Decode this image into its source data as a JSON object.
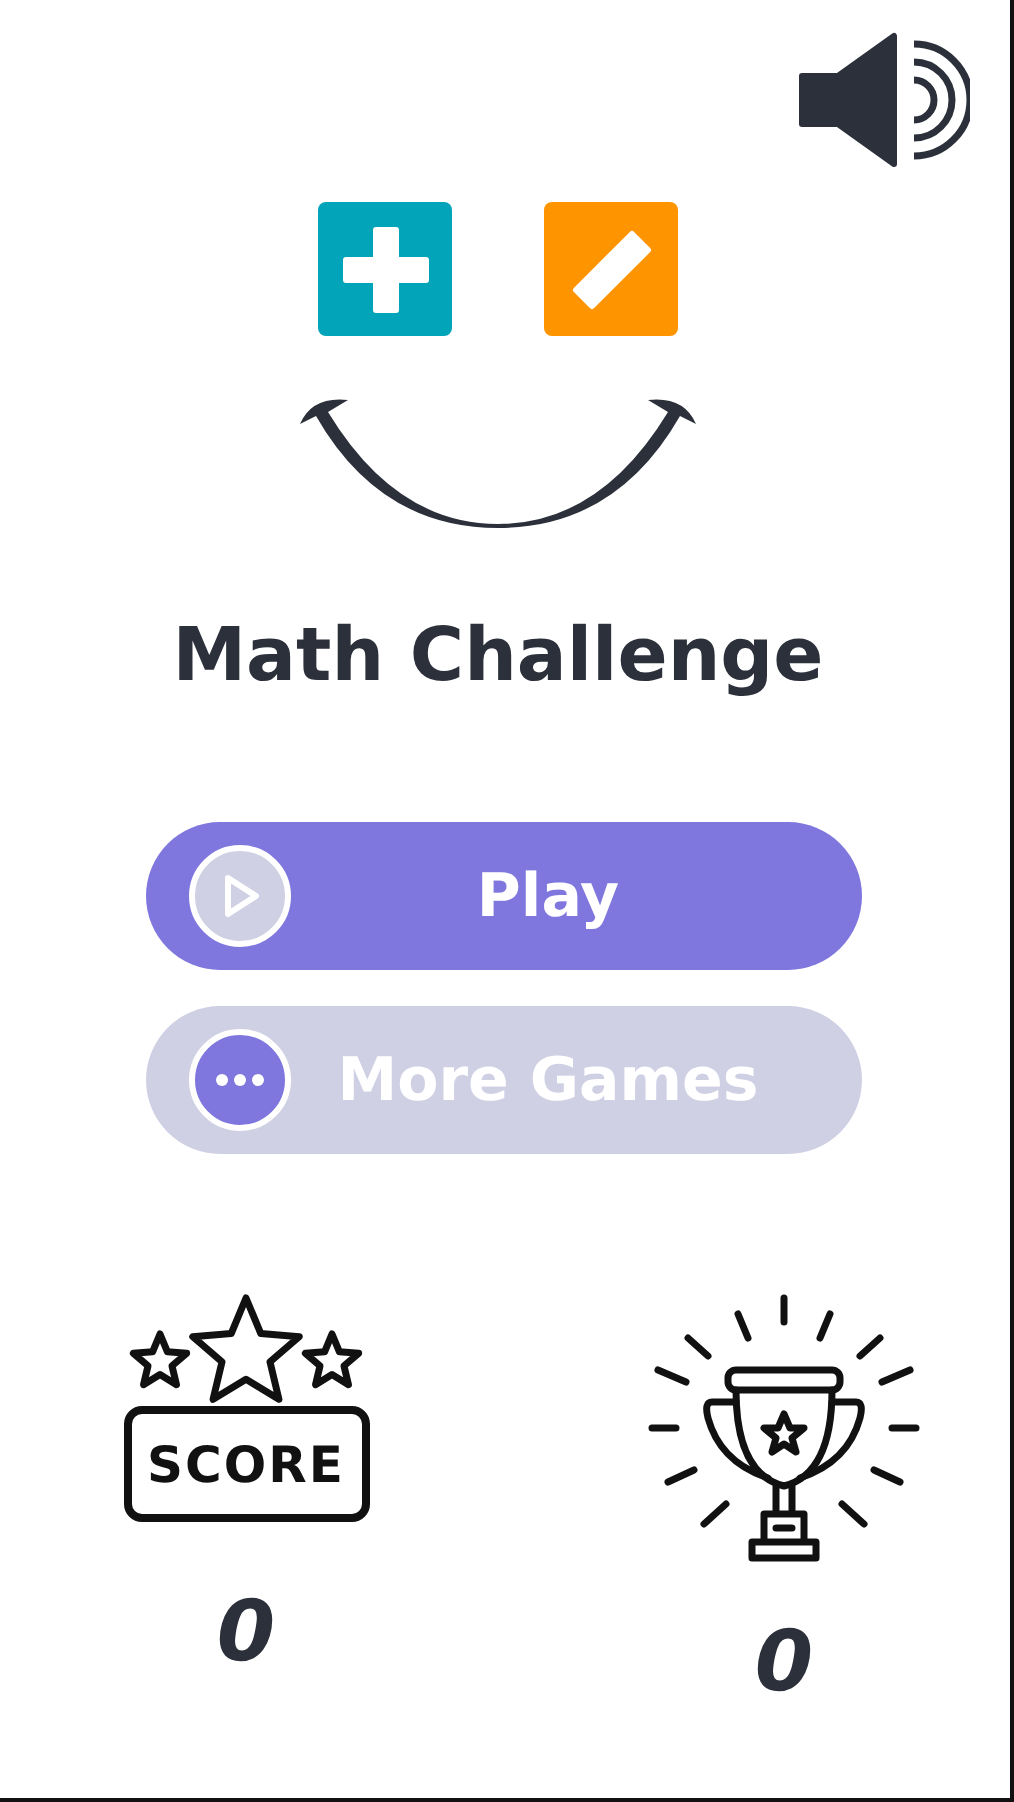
{
  "sound_on": true,
  "title": "Math Challenge",
  "buttons": [
    {
      "kind": "play",
      "label": "Play"
    },
    {
      "kind": "more",
      "label": "More Games"
    }
  ],
  "stats": [
    {
      "kind": "score",
      "label": "SCORE",
      "value": "0"
    },
    {
      "kind": "trophy",
      "value": "0"
    }
  ]
}
